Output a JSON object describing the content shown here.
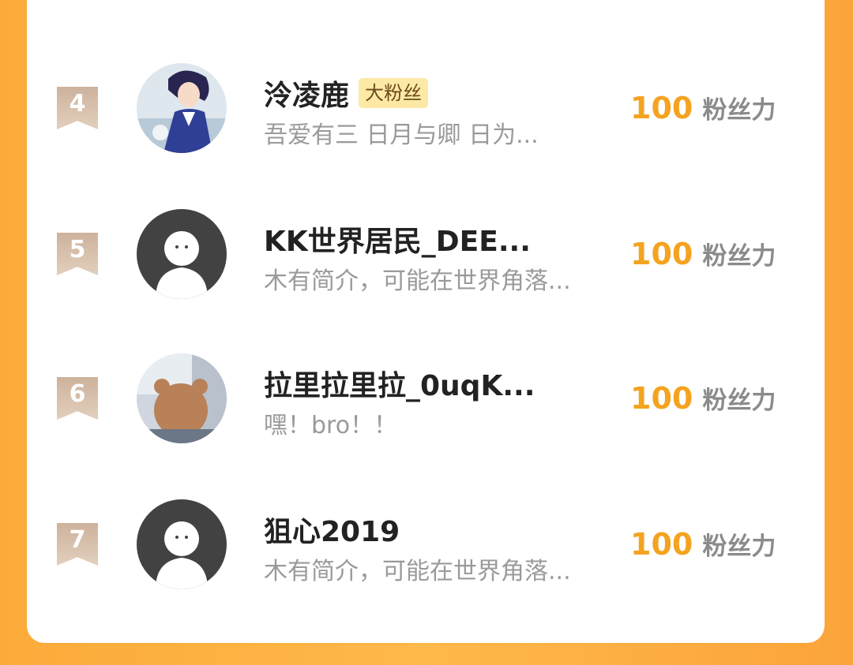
{
  "colors": {
    "background_orange": "#fba43a",
    "card": "#ffffff",
    "score": "#f4a321",
    "rank_badge": "#cdb29c",
    "fan_badge_bg": "#fde9a6"
  },
  "rows": [
    {
      "rank": "4",
      "name": "泠凌鹿",
      "badge": "大粉丝",
      "bio": "吾爱有三 日月与卿 日为...",
      "score": "100",
      "score_label": "粉丝力",
      "avatar": "anime-boy-avatar"
    },
    {
      "rank": "5",
      "name": "KK世界居民_DEE...",
      "bio": "木有简介，可能在世界角落...",
      "score": "100",
      "score_label": "粉丝力",
      "avatar": "default-avatar"
    },
    {
      "rank": "6",
      "name": "拉里拉里拉_0uqK...",
      "bio": "嘿！bro！！",
      "score": "100",
      "score_label": "粉丝力",
      "avatar": "bear-avatar"
    },
    {
      "rank": "7",
      "name": "狙心2019",
      "bio": "木有简介，可能在世界角落...",
      "score": "100",
      "score_label": "粉丝力",
      "avatar": "default-avatar"
    }
  ]
}
